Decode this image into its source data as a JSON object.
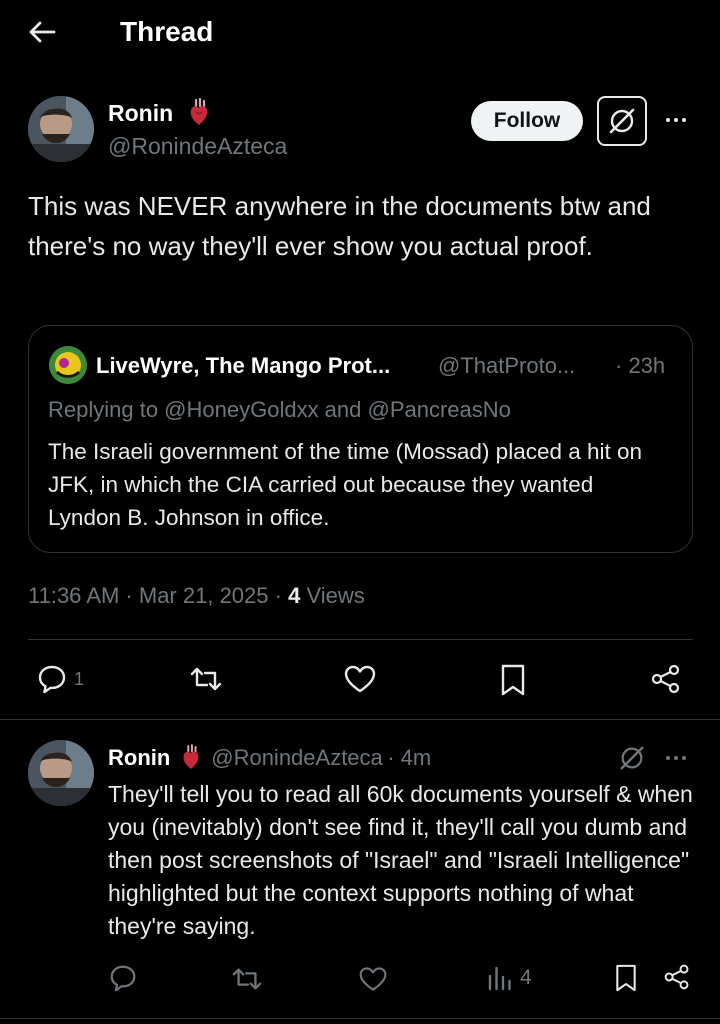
{
  "header": {
    "title": "Thread"
  },
  "tweet": {
    "author": {
      "name": "Ronin",
      "handle": "@RonindeAzteca"
    },
    "follow_label": "Follow",
    "text": "This was NEVER anywhere in the documents btw and there's no way they'll ever show you actual proof.",
    "timestamp": "11:36 AM · Mar 21, 2025 · ",
    "views_count": "4",
    "views_label": "Views",
    "reply_count": "1"
  },
  "quote": {
    "author": {
      "name": "LiveWyre, The Mango Prot...",
      "handle": "@ThatProto..."
    },
    "time": "· 23h",
    "replying_to": "Replying to @HoneyGoldxx and @PancreasNo",
    "text": "The Israeli government of the time (Mossad) placed a hit on JFK, in which the CIA carried out because they wanted Lyndon B. Johnson in office."
  },
  "reply": {
    "author": {
      "name": "Ronin",
      "handle": "@RonindeAzteca"
    },
    "time": "· 4m",
    "text": "They'll tell you to read all 60k documents yourself & when you (inevitably) don't see find it, they'll call you dumb and then post screenshots of \"Israel\" and \"Israeli Intelligence\" highlighted but the context supports nothing of what they're saying.",
    "views_count": "4"
  },
  "icons": {
    "back": "arrow-left-icon",
    "grok": "grok-icon",
    "more": "more-dots-icon",
    "reply": "comment-icon",
    "retweet": "retweet-icon",
    "like": "heart-icon",
    "bookmark": "bookmark-icon",
    "share": "share-icon",
    "views": "views-chart-icon",
    "anatomical_heart": "anatomical-heart-emoji"
  },
  "colors": {
    "background": "#000000",
    "text": "#e7e9ea",
    "muted": "#71767b",
    "border": "#2f3336",
    "button": "#eff3f4",
    "heart_emoji": "#c8283c"
  }
}
